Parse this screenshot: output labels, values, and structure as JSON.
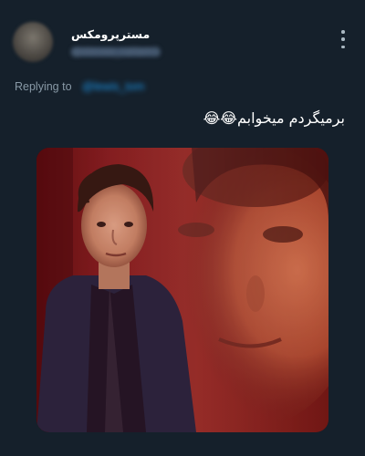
{
  "user": {
    "display_name": "مستر‌پرومکس",
    "handle": "@stevee_callam1",
    "avatar_icon": "profile-avatar-icon"
  },
  "menu": {
    "icon": "more-vertical-icon"
  },
  "reply": {
    "prefix": "Replying to",
    "target": "@lewis_tom"
  },
  "tweet": {
    "text": "برمیگردم میخوابم😂😂"
  },
  "media": {
    "description_icon": "meme-photo",
    "colors": {
      "background": "#15202b",
      "accent_link": "#1d9bf0",
      "muted_text": "#8899a6"
    }
  }
}
